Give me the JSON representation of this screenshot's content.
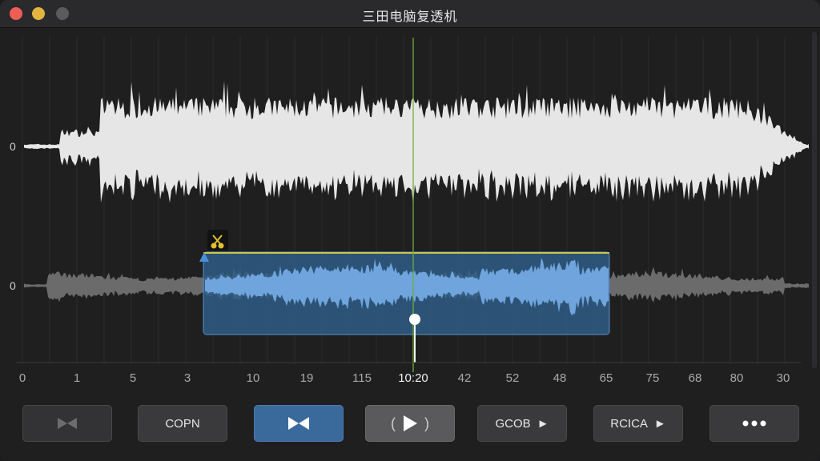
{
  "window": {
    "title": "三田电脑复透机"
  },
  "tracks": [
    {
      "zero_label": "0"
    },
    {
      "zero_label": "0"
    }
  ],
  "timeline": {
    "labels": [
      "0",
      "1",
      "5",
      "3",
      "10",
      "19",
      "115",
      "10:20",
      "42",
      "52",
      "48",
      "65",
      "75",
      "68",
      "80",
      "30"
    ]
  },
  "selection": {
    "marker_icon": "scissors-icon"
  },
  "toolbar": {
    "buttons": [
      {
        "name": "bowtie-dim-button",
        "label": "",
        "icon": "bowtie-icon"
      },
      {
        "name": "copn-button",
        "label": "COPN"
      },
      {
        "name": "bowtie-active-button",
        "label": "",
        "icon": "bowtie-icon"
      },
      {
        "name": "play-button",
        "label": "",
        "icon": "play-icon"
      },
      {
        "name": "gcob-button",
        "label": "GCOB"
      },
      {
        "name": "rcica-button",
        "label": "RCICA"
      },
      {
        "name": "more-button",
        "label": "",
        "icon": "more-icon"
      }
    ]
  },
  "colors": {
    "waveform_top": "#e6e6e6",
    "waveform_bottom": "#6b6b6b",
    "selection_fill": "#2f5d86",
    "selection_wave": "#6fa4dd",
    "selection_top_line": "#c8c84a",
    "playhead": "#6fae3f"
  }
}
